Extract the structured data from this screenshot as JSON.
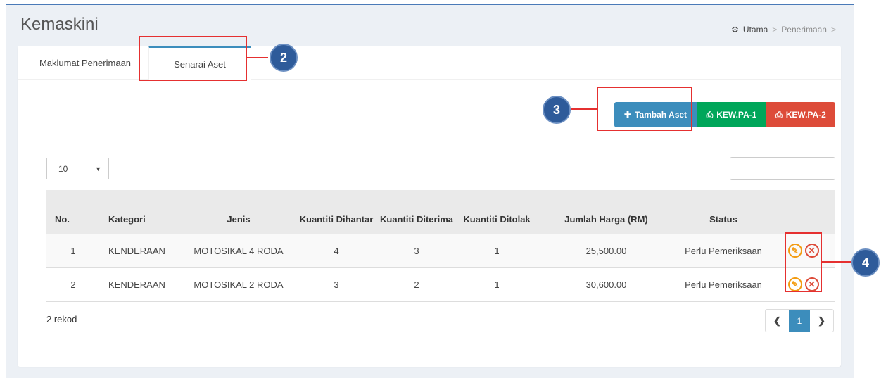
{
  "page": {
    "title": "Kemaskini",
    "breadcrumb": [
      "Utama",
      "Penerimaan"
    ]
  },
  "tabs": [
    {
      "label": "Maklumat Penerimaan"
    },
    {
      "label": "Senarai Aset"
    }
  ],
  "toolbar": {
    "tambah_label": "Tambah Aset",
    "pa1_label": "KEW.PA-1",
    "pa2_label": "KEW.PA-2"
  },
  "table_controls": {
    "page_length": "10",
    "search_value": ""
  },
  "table": {
    "headers": [
      "No.",
      "Kategori",
      "Jenis",
      "Kuantiti Dihantar",
      "Kuantiti Diterima",
      "Kuantiti Ditolak",
      "Jumlah Harga (RM)",
      "Status",
      ""
    ],
    "rows": [
      {
        "no": "1",
        "kategori": "KENDERAAN",
        "jenis": "MOTOSIKAL 4 RODA",
        "dihantar": "4",
        "diterima": "3",
        "ditolak": "1",
        "harga": "25,500.00",
        "status": "Perlu Pemeriksaan"
      },
      {
        "no": "2",
        "kategori": "KENDERAAN",
        "jenis": "MOTOSIKAL 2 RODA",
        "dihantar": "3",
        "diterima": "2",
        "ditolak": "1",
        "harga": "30,600.00",
        "status": "Perlu Pemeriksaan"
      }
    ]
  },
  "footer": {
    "record_count": "2 rekod",
    "current_page": "1"
  },
  "markers": [
    "2",
    "3",
    "4"
  ],
  "colors": {
    "primary": "#3c8dbc",
    "success": "#00a65a",
    "danger": "#dd4b39",
    "warning": "#f39c12",
    "highlight": "#e53030"
  }
}
